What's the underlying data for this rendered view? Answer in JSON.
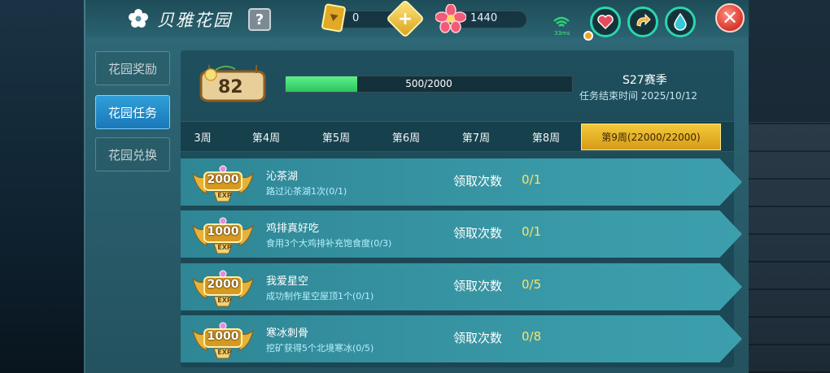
{
  "header": {
    "title": "贝雅花园",
    "help_label": "?",
    "resource1_value": "0",
    "resource2_value": "1440",
    "wifi_label": "33ms",
    "close_label": "✕"
  },
  "sidebar": {
    "items": [
      {
        "label": "花园奖励",
        "active": false
      },
      {
        "label": "花园任务",
        "active": true
      },
      {
        "label": "花园兑换",
        "active": false
      }
    ]
  },
  "level": {
    "value": "82",
    "progress_text": "500/2000",
    "progress_fraction": 0.25
  },
  "season": {
    "name": "S27赛季",
    "end_text": "任务结束时间 2025/10/12"
  },
  "weeks": [
    {
      "label": "3周",
      "active": false
    },
    {
      "label": "第4周",
      "active": false
    },
    {
      "label": "第5周",
      "active": false
    },
    {
      "label": "第6周",
      "active": false
    },
    {
      "label": "第7周",
      "active": false
    },
    {
      "label": "第8周",
      "active": false
    },
    {
      "label": "第9周(22000/22000)",
      "active": true
    }
  ],
  "tasks": [
    {
      "exp": "2000",
      "exp_tag": "EXP",
      "name": "沁茶湖",
      "desc": "路过沁茶湖1次(0/1)",
      "count_label": "领取次数",
      "count": "0/1"
    },
    {
      "exp": "1000",
      "exp_tag": "EXP",
      "name": "鸡排真好吃",
      "desc": "食用3个大鸡排补充饱食度(0/3)",
      "count_label": "领取次数",
      "count": "0/1"
    },
    {
      "exp": "2000",
      "exp_tag": "EXP",
      "name": "我爱星空",
      "desc": "成功制作星空屋顶1个(0/1)",
      "count_label": "领取次数",
      "count": "0/5"
    },
    {
      "exp": "1000",
      "exp_tag": "EXP",
      "name": "寒冰刺骨",
      "desc": "挖矿获得5个北境寒冰(0/5)",
      "count_label": "领取次数",
      "count": "0/8"
    }
  ],
  "colors": {
    "accent_gold": "#f4c93a",
    "progress_green": "#3dd46b",
    "count_yellow": "#ffe26a",
    "tab_blue": "#2f9fd8"
  },
  "icons": {
    "title_icon": "flower-icon",
    "resource1_icon": "gold-ticket-icon",
    "resource2_icon": "pink-flower-gem-icon",
    "status_icons": [
      "heart-icon",
      "arrow-loop-icon",
      "water-drop-icon"
    ]
  }
}
